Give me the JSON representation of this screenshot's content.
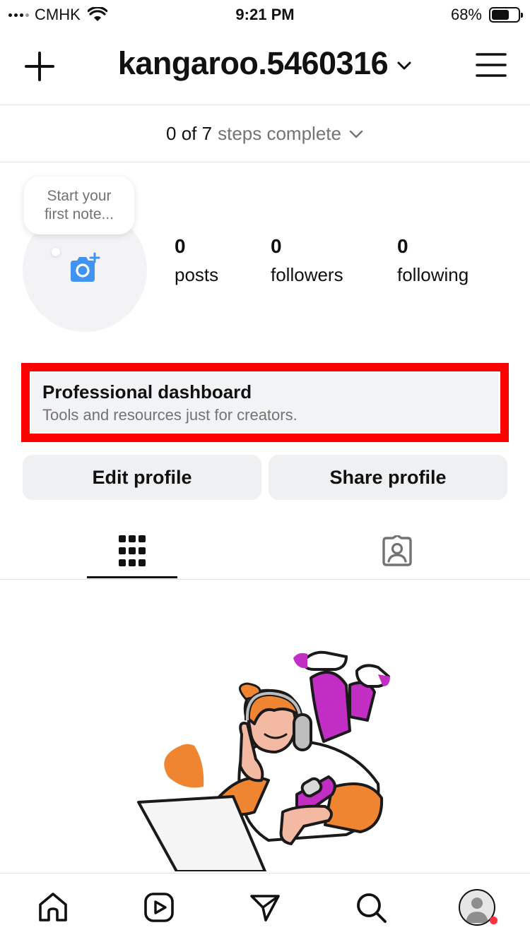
{
  "status_bar": {
    "carrier": "CMHK",
    "time": "9:21 PM",
    "battery": "68%",
    "battery_level": 0.68
  },
  "header": {
    "username": "kangaroo.5460316",
    "icons": [
      "plus-icon",
      "chevron-down-icon",
      "hamburger-menu-icon"
    ]
  },
  "steps": {
    "count": "0 of 7",
    "label": "steps complete"
  },
  "note": {
    "placeholder": "Start your first note..."
  },
  "stats": [
    {
      "value": "0",
      "label": "posts"
    },
    {
      "value": "0",
      "label": "followers"
    },
    {
      "value": "0",
      "label": "following"
    }
  ],
  "professional_dashboard": {
    "title": "Professional dashboard",
    "subtitle": "Tools and resources just for creators."
  },
  "actions": {
    "edit": "Edit profile",
    "share": "Share profile"
  },
  "tabs": [
    {
      "icon": "grid-icon",
      "active": true
    },
    {
      "icon": "tagged-person-icon",
      "active": false
    }
  ],
  "bottom_nav": {
    "items": [
      "home-icon",
      "reels-icon",
      "direct-message-icon",
      "search-icon",
      "profile-icon"
    ],
    "notification_color": "#ff3040"
  },
  "colors": {
    "highlight_frame": "#fe0000",
    "accent_blue": "#4193f3",
    "illustration_orange": "#ef8530",
    "illustration_purple": "#c22ec4"
  }
}
